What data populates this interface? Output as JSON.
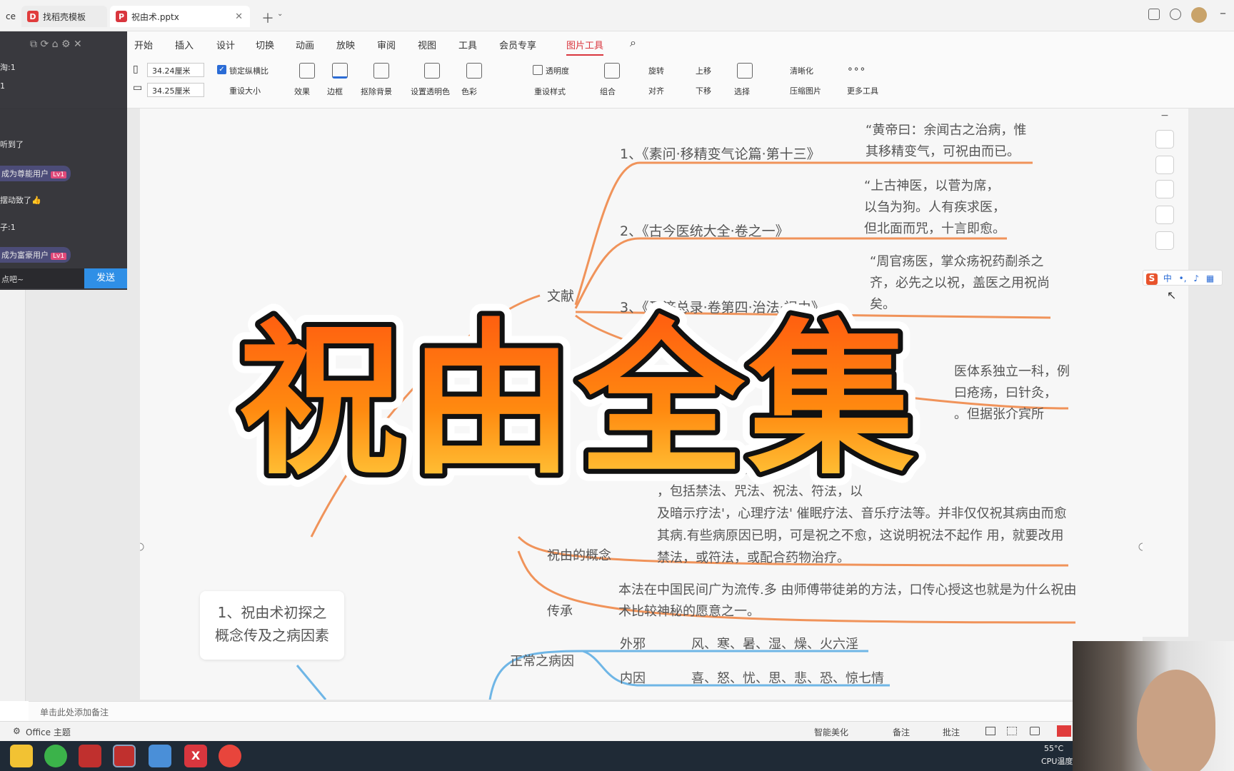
{
  "tabs": [
    {
      "label": "ce"
    },
    {
      "label": "找稻壳模板"
    },
    {
      "label": "祝由术.pptx",
      "active": true
    }
  ],
  "menus": [
    "开始",
    "插入",
    "设计",
    "切换",
    "动画",
    "放映",
    "审阅",
    "视图",
    "工具",
    "会员专享",
    "图片工具"
  ],
  "ribbon": {
    "width_value": "34.24厘米",
    "height_value": "34.25厘米",
    "lock_ratio": "锁定纵横比",
    "reset_size": "重设大小",
    "effects": "效果",
    "border": "边框",
    "crop_bg": "抠除背景",
    "set_transparent": "设置透明色",
    "color": "色彩",
    "transparency": "透明度",
    "reset_style": "重设样式",
    "group": "组合",
    "rotate": "旋转",
    "align": "对齐",
    "up": "上移",
    "down": "下移",
    "select": "选择",
    "sharpen": "清晰化",
    "compress": "压缩图片",
    "more_tools": "更多工具"
  },
  "chat": {
    "lines": [
      "淘:1",
      "1",
      "听到了",
      "成为尊能用户",
      "摆动致了",
      "子:1",
      "成为富豪用户"
    ],
    "badge": "Lv1",
    "input_placeholder": "点吧~",
    "send": "发送"
  },
  "mindmap": {
    "root": "1、祝由术初探之\n概念传及之病因素",
    "branch_wenxian": "文献",
    "ref1": "1、《素问·移精变气论篇·第十三》",
    "ref1_text": "“黄帝曰：余闻古之治病，惟\n其移精变气，可祝由而已。",
    "ref2": "2、《古今医统大全·卷之一》",
    "ref2_text": "“上古神医，以菅为席，\n以刍为狗。人有疾求医，\n但北面而咒，十言即愈。",
    "ref3": "3、《圣济总录·卷第四·治法·祝由》",
    "ref3_text": "“周官疡医，掌众疡祝药劀杀之\n齐，必先之以祝，盖医之用祝尚\n矣。",
    "ref4_text": "医体系独立一科，例\n曰疮疡，曰针灸，\n。但据张介宾所",
    "concept_label": "祝由的概念",
    "concept_text": "神方，“祝”者咒也，\n，包括禁法、咒法、祝法、符法，以\n及暗示疗法'，心理疗法' 催眠疗法、音乐疗法等。并非仅仅祝其病由而愈\n其病.有些病原因已明，可是祝之不愈，这说明祝法不起作 用，就要改用\n禁法，或符法，或配合药物治疗。",
    "inherit_label": "传承",
    "inherit_text": "本法在中国民间广为流传.多 由师傅带徒弟的方法，口传心授这也就是为什么祝由\n术比较神秘的愿意之一。",
    "cause_label": "正常之病因",
    "outer_label": "外邪",
    "outer_text": "风、寒、暑、湿、燥、火六淫",
    "inner_label": "内因",
    "inner_text": "喜、怒、忧、思、悲、恐、惊七情"
  },
  "overlay_title": "祝由全集",
  "notes_placeholder": "单击此处添加备注",
  "status": {
    "theme": "Office 主题",
    "smart": "智能美化",
    "notes": "备注",
    "comment": "批注"
  },
  "ime": {
    "mode": "中"
  },
  "tray": {
    "temp": "55°C",
    "cpu": "CPU温度"
  },
  "colors": {
    "orange_branch": "#f0935a",
    "blue_branch": "#6fb6e6",
    "title_fill": "#f7a21b",
    "wps_red": "#d9363e"
  }
}
